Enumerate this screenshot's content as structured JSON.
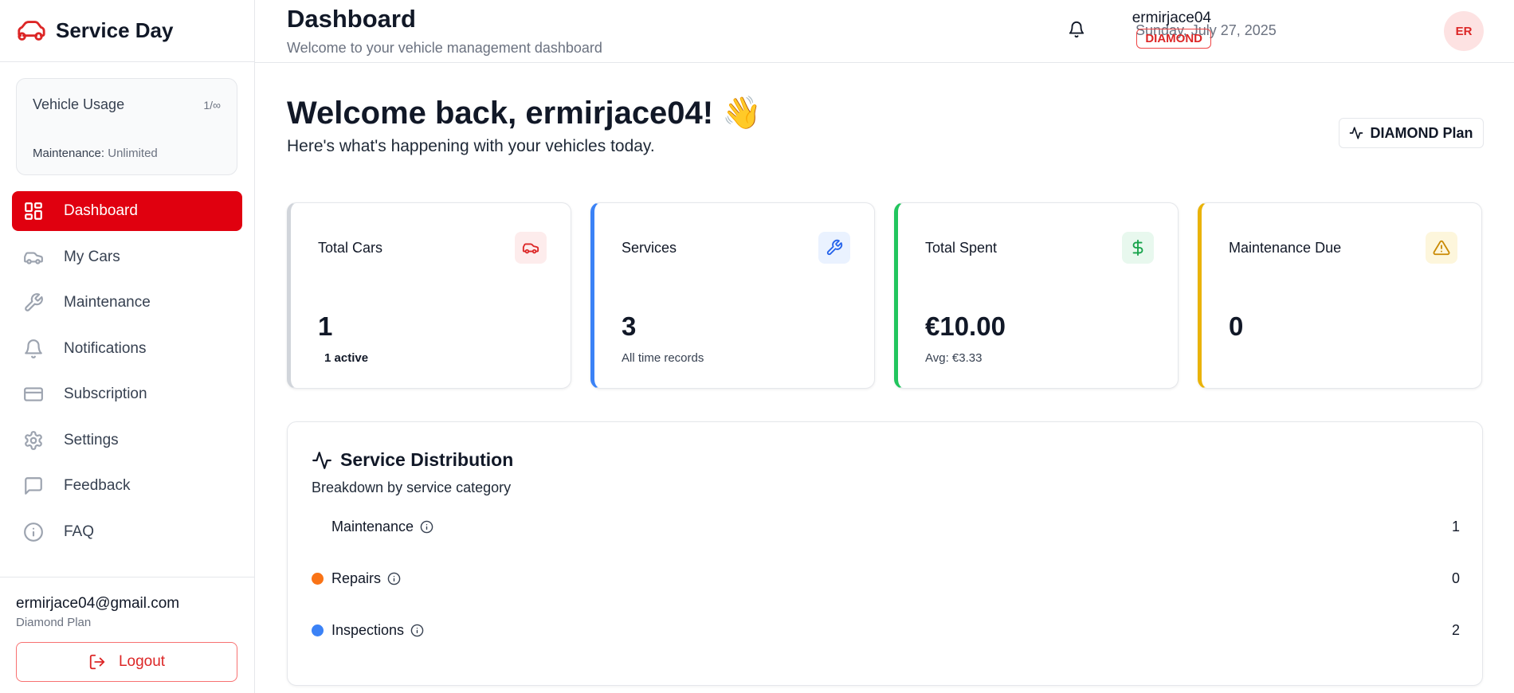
{
  "brand": {
    "name": "Service Day"
  },
  "usage": {
    "title": "Vehicle Usage",
    "count": "1/∞",
    "maintenance_label": "Maintenance:",
    "maintenance_value": "Unlimited"
  },
  "nav": {
    "items": [
      {
        "label": "Dashboard",
        "icon": "grid-icon",
        "active": true
      },
      {
        "label": "My Cars",
        "icon": "car-icon"
      },
      {
        "label": "Maintenance",
        "icon": "wrench-icon"
      },
      {
        "label": "Notifications",
        "icon": "bell-icon"
      },
      {
        "label": "Subscription",
        "icon": "credit-card-icon"
      },
      {
        "label": "Settings",
        "icon": "gear-icon"
      },
      {
        "label": "Feedback",
        "icon": "message-icon"
      },
      {
        "label": "FAQ",
        "icon": "info-icon"
      }
    ]
  },
  "sidebar_footer": {
    "email": "ermirjace04@gmail.com",
    "plan": "Diamond Plan",
    "logout_label": "Logout"
  },
  "header": {
    "title": "Dashboard",
    "subtitle": "Welcome to your vehicle management dashboard",
    "date": "Sunday, July 27, 2025",
    "username": "ermirjace04",
    "tier": "DIAMOND",
    "avatar_initials": "ER"
  },
  "welcome": {
    "title": "Welcome back, ermirjace04! 👋",
    "subtitle": "Here's what's happening with your vehicles today.",
    "plan_button": "DIAMOND Plan"
  },
  "stats": [
    {
      "label": "Total Cars",
      "value": "1",
      "sub": "1 active",
      "icon": "car-icon",
      "accent": "#d1d5db",
      "icon_color": "#dc2626",
      "icon_bg": "#fdecec"
    },
    {
      "label": "Services",
      "value": "3",
      "sub": "All time records",
      "icon": "wrench-icon",
      "accent": "#3b82f6",
      "icon_color": "#2563eb",
      "icon_bg": "#eaf2ff"
    },
    {
      "label": "Total Spent",
      "value": "€10.00",
      "sub": "Avg: €3.33",
      "icon": "dollar-icon",
      "accent": "#22c55e",
      "icon_color": "#16a34a",
      "icon_bg": "#e8f8ee"
    },
    {
      "label": "Maintenance Due",
      "value": "0",
      "sub": "",
      "icon": "warning-icon",
      "accent": "#eab308",
      "icon_color": "#ca8a04",
      "icon_bg": "#fdf6dc"
    }
  ],
  "distribution": {
    "title": "Service Distribution",
    "subtitle": "Breakdown by service category",
    "rows": [
      {
        "name": "Maintenance",
        "count": "1",
        "color": ""
      },
      {
        "name": "Repairs",
        "count": "0",
        "color": "#f97316"
      },
      {
        "name": "Inspections",
        "count": "2",
        "color": "#3b82f6"
      }
    ]
  }
}
